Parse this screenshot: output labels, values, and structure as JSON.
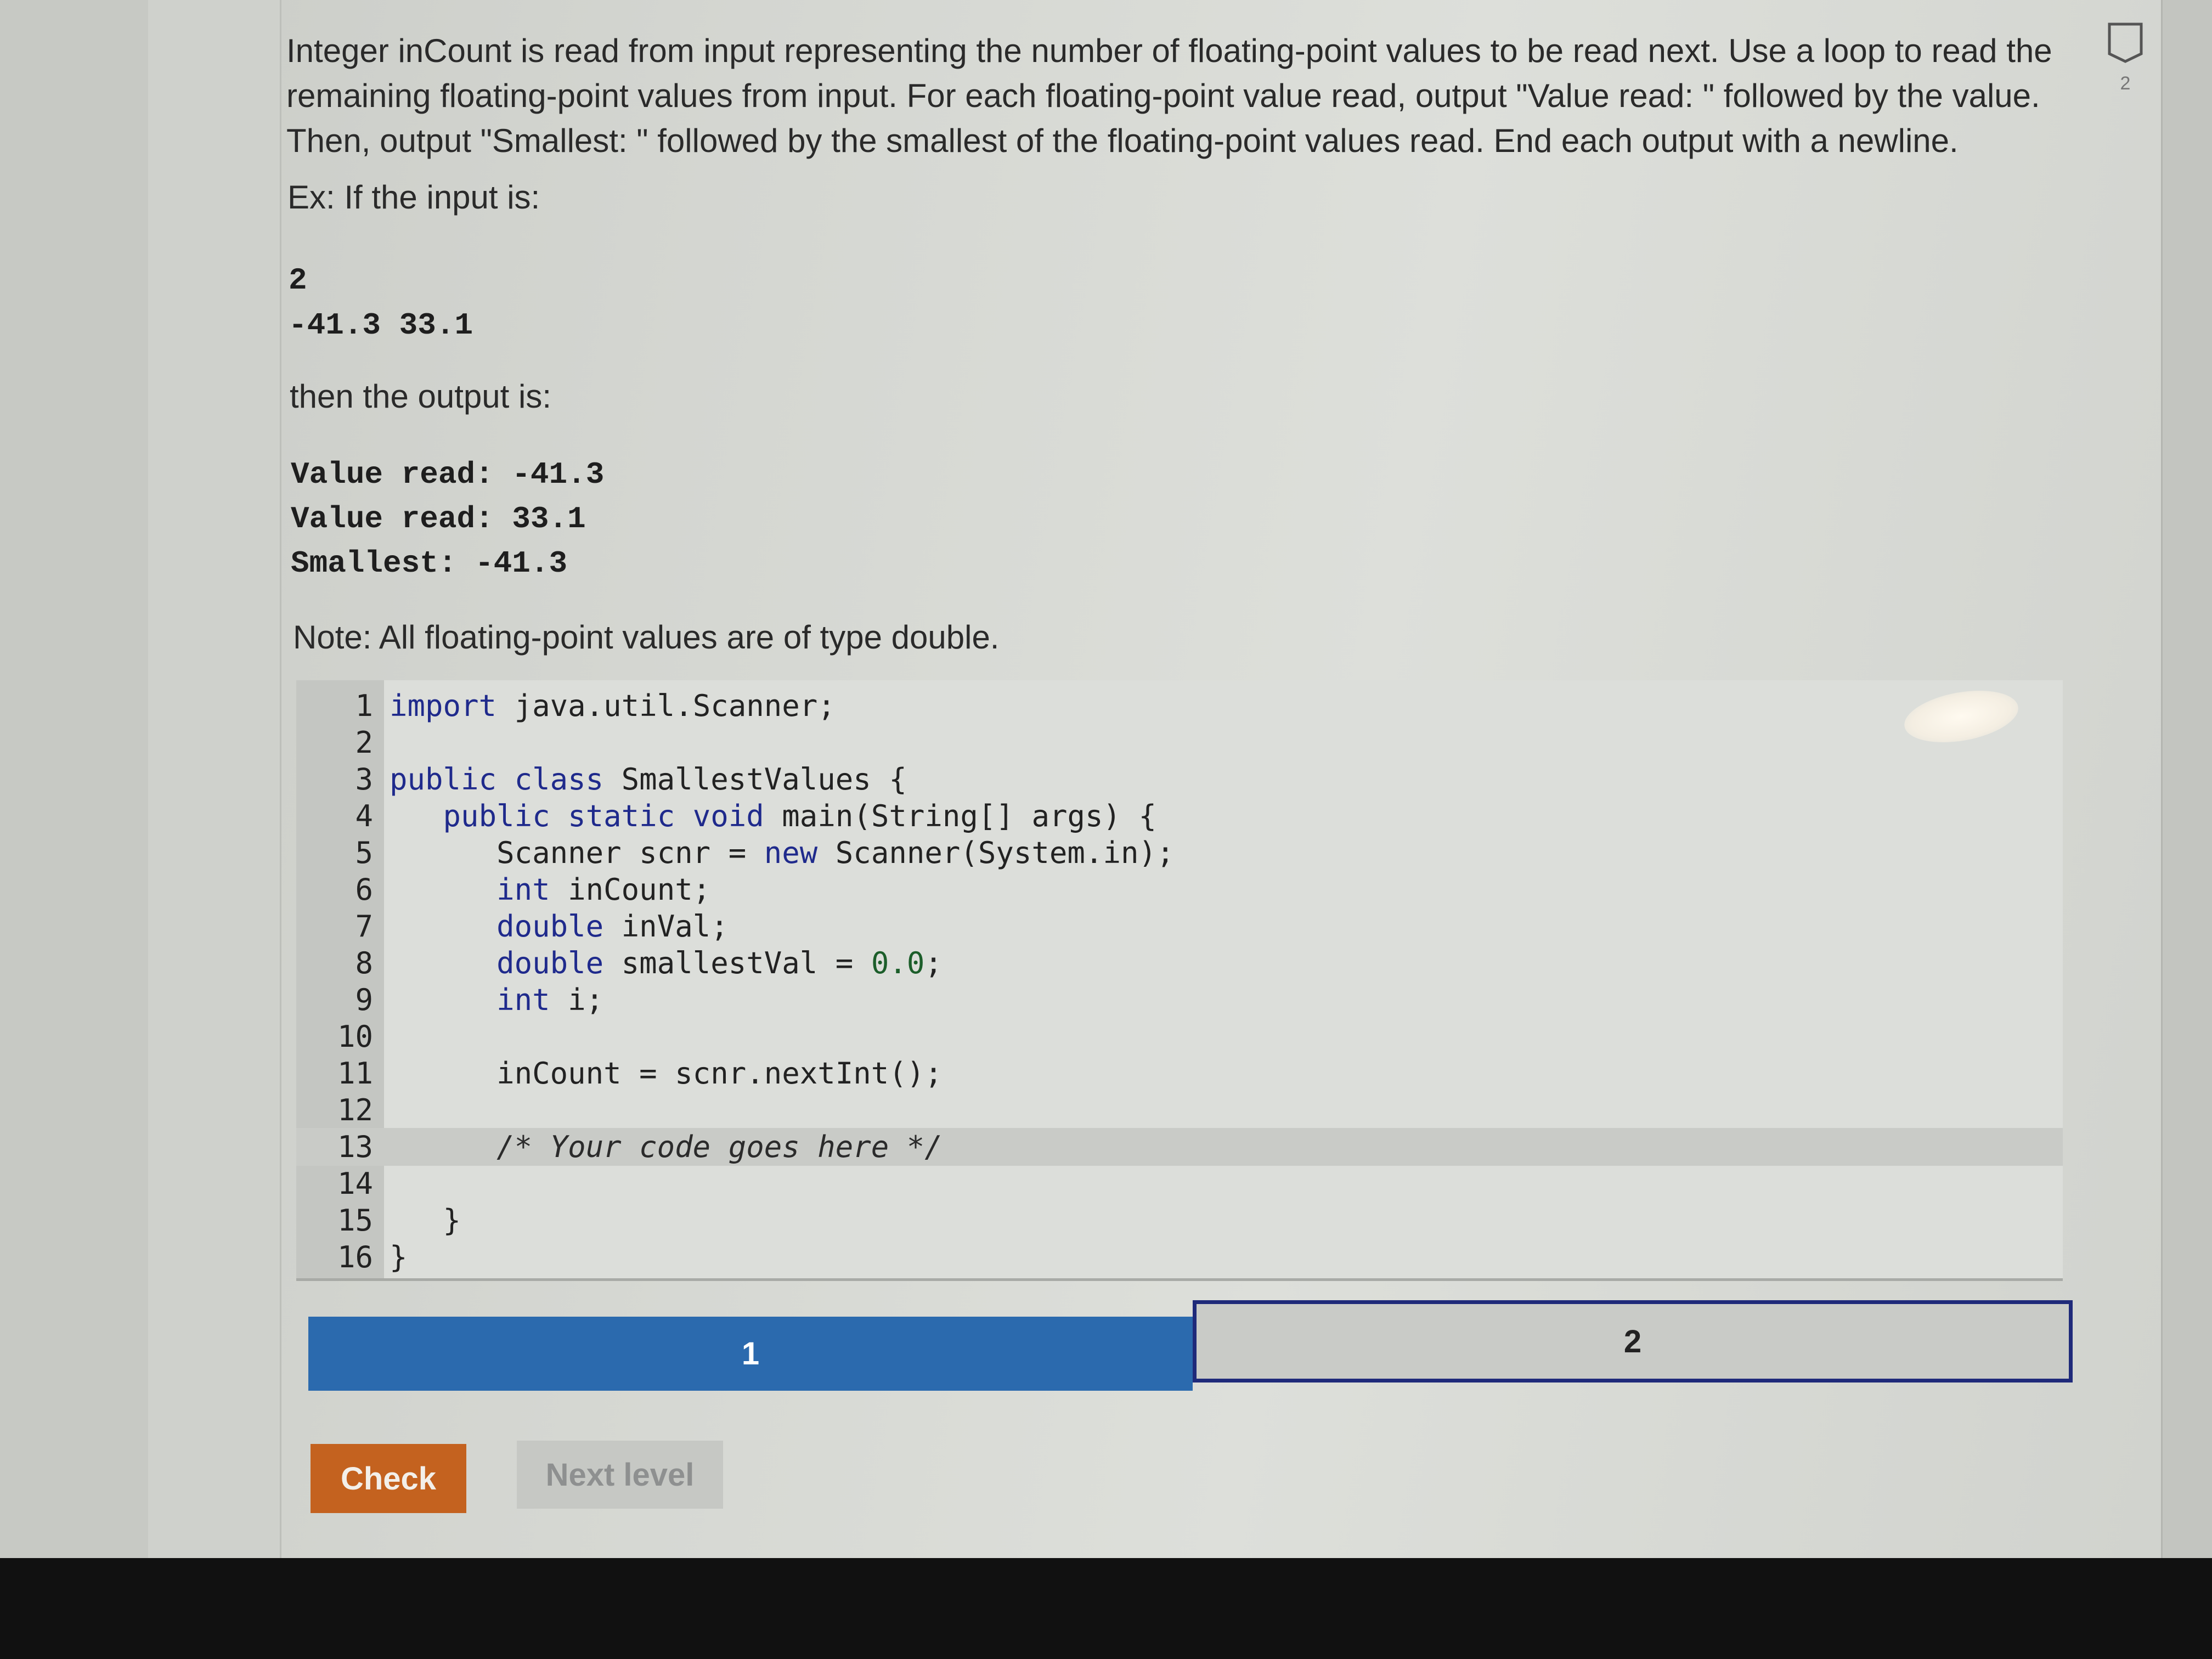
{
  "prompt": {
    "text": "Integer inCount is read from input representing the number of floating-point values to be read next. Use a loop to read the remaining floating-point values from input. For each floating-point value read, output \"Value read: \" followed by the value. Then, output \"Smallest: \" followed by the smallest of the floating-point values read. End each output with a newline.",
    "example_label": "Ex: If the input is:",
    "example_input": [
      "2",
      "-41.3 33.1"
    ],
    "then_label": "then the output is:",
    "example_output": [
      "Value read: -41.3",
      "Value read: 33.1",
      "Smallest: -41.3"
    ],
    "note": "Note: All floating-point values are of type double."
  },
  "editor": {
    "lines": [
      {
        "n": "1",
        "code": "import java.util.Scanner;"
      },
      {
        "n": "2",
        "code": ""
      },
      {
        "n": "3",
        "code": "public class SmallestValues {"
      },
      {
        "n": "4",
        "code": "   public static void main(String[] args) {"
      },
      {
        "n": "5",
        "code": "      Scanner scnr = new Scanner(System.in);"
      },
      {
        "n": "6",
        "code": "      int inCount;"
      },
      {
        "n": "7",
        "code": "      double inVal;"
      },
      {
        "n": "8",
        "code": "      double smallestVal = 0.0;"
      },
      {
        "n": "9",
        "code": "      int i;"
      },
      {
        "n": "10",
        "code": ""
      },
      {
        "n": "11",
        "code": "      inCount = scnr.nextInt();"
      },
      {
        "n": "12",
        "code": ""
      },
      {
        "n": "13",
        "code": "      /* Your code goes here */"
      },
      {
        "n": "14",
        "code": ""
      },
      {
        "n": "15",
        "code": "   }"
      },
      {
        "n": "16",
        "code": "}"
      }
    ],
    "active_line": 13
  },
  "levels": {
    "items": [
      {
        "label": "1",
        "state": "completed"
      },
      {
        "label": "2",
        "state": "current"
      }
    ],
    "completed_color": "#2b6aae",
    "current_border_color": "#1f2a7a"
  },
  "buttons": {
    "check": "Check",
    "next_level": "Next level",
    "check_color": "#c4621f"
  },
  "side_badge": {
    "icon": "shield-badge-icon",
    "count": "2"
  }
}
